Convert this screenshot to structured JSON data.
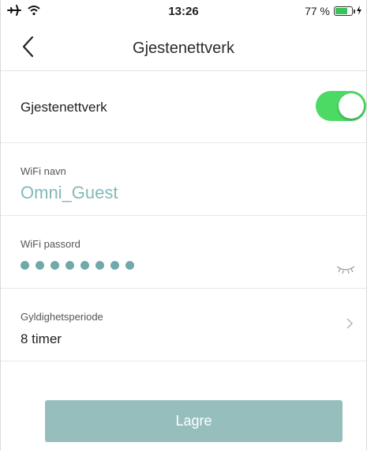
{
  "status_bar": {
    "time": "13:26",
    "battery_text": "77 %",
    "battery_level": 0.77,
    "icons": [
      "airplane-icon",
      "wifi-icon",
      "battery-icon",
      "charging-icon"
    ]
  },
  "nav": {
    "title": "Gjestenettverk",
    "back_icon": "chevron-left-icon"
  },
  "guest_network": {
    "label": "Gjestenettverk",
    "enabled": true
  },
  "wifi_name": {
    "label": "WiFi navn",
    "value": "Omni_Guest"
  },
  "wifi_password": {
    "label": "WiFi passord",
    "masked": "••••••••",
    "icon": "eye-closed-icon"
  },
  "validity": {
    "label": "Gyldighetsperiode",
    "value": "8 timer"
  },
  "save_label": "Lagre",
  "colors": {
    "accent": "#85b8b8",
    "toggle_on": "#4cd964",
    "save_button": "#96bebd"
  }
}
